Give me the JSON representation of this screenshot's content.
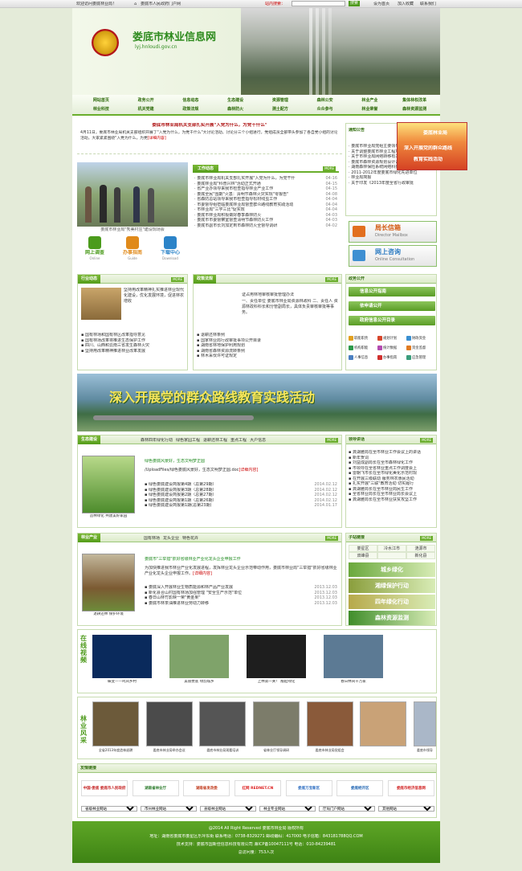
{
  "topbar": {
    "welcome": "欢迎访问娄底林业局！",
    "portal": "娄底市人民政府门户网",
    "search_label": "站内搜索：",
    "search_button": "搜索",
    "links": [
      "设为首页",
      "加入收藏",
      "联系我们"
    ]
  },
  "header": {
    "title": "娄底市林业信息网",
    "url": "lyj.hnloudi.gov.cn"
  },
  "nav": {
    "row1": [
      "网站首页",
      "政务公开",
      "信息动态",
      "生态建设",
      "资源管理",
      "森林公安",
      "林业产业",
      "集体林权改革"
    ],
    "row2": [
      "林业科技",
      "机关党建",
      "政策法规",
      "森林防火",
      "测土配方",
      "众众参与",
      "林业荣誉",
      "森林资源监测"
    ]
  },
  "headline": {
    "title": "娄底市林业局机关支部扎实开展\"入党为什么，为党干什么\"",
    "body": "4月11日，娄底市林业局机关支部组织开展了\"入党为什么，为党干什么\"大讨论活动，讨论分三个小组进行，党组成员全部带头参加了各自党小组的讨论活动。大家紧紧围绕\"入党为什么，为党",
    "more": "[详细内容]",
    "photo_caption": "娄底市林业局\"秀美村庄\"建设现场会"
  },
  "quick_links": [
    {
      "label": "网上调查",
      "sub": "Online"
    },
    {
      "label": "办事指南",
      "sub": "Guide"
    },
    {
      "label": "下载中心",
      "sub": "Download"
    }
  ],
  "work_news": {
    "title": "工作动态",
    "more": "MORE",
    "items": [
      {
        "text": "娄底市林业局机关支部扎实开展\"入党为什么，为党干什",
        "date": "04-16"
      },
      {
        "text": "娄底林业局\"科普兴林\"活动正式开通",
        "date": "04-15"
      },
      {
        "text": "省产业办领导来我市检查指导林业产业工作",
        "date": "04-15"
      },
      {
        "text": "娄底全民\"围剿\"火患：清明节森林火灾实现\"零报告\"",
        "date": "04-08"
      },
      {
        "text": "省森防总站领导来我市检查指导松材线虫工作",
        "date": "04-04"
      },
      {
        "text": "市委督导组莅临娄底林业局督查群众路线教育实践活动",
        "date": "04-04"
      },
      {
        "text": "市林业局\"三学三比\"促实效",
        "date": "04-04"
      },
      {
        "text": "娄底市林业局积极做好春季森林防火",
        "date": "04-03"
      },
      {
        "text": "娄底市市委督察室督查清明节森林防火工作",
        "date": "04-03"
      },
      {
        "text": "娄底市副市长刘加定到市森林防火全督导调研",
        "date": "04-02"
      }
    ]
  },
  "notice": {
    "title": "通知公告",
    "banner": [
      "娄底林业局",
      "深入开展党的群众路线",
      "教育实践活动"
    ],
    "items": [
      "娄底市林业局党组主要领导联系点",
      "关于调整娄底市林业工程项目建设",
      "关于市林业局网络转移有关事项的通",
      "娄底市森林资源规划设计调查招标公",
      "湖南森林保险系统网络科技工程建设",
      "2011-2012年度娄底市绿化先进单位",
      "林业局简报",
      "关于印发《2013年度全省行政审批"
    ]
  },
  "mailbox": {
    "label": "局长信箱",
    "sub": "Director Mailbox"
  },
  "consult": {
    "label": "网上咨询",
    "sub": "Online Consultation"
  },
  "industry_news": {
    "title": "行业动态",
    "more": "MORE",
    "lead": "坚持用改革精神扎实推进林业现代化建设，优化发展环境，促进林农增收",
    "items": [
      "国有林场和国有林区改革指导意见",
      "国有林场改革将推进生态保护工作",
      "四川、山西和云南三省发生森林火灾",
      "坚持用改革精神推进林业改革发展"
    ]
  },
  "policy": {
    "title": "政策法规",
    "more": "MORE",
    "lead": "证占用林地审核审批管理办法",
    "body": "一、责任单位 娄底市林业局资源林政科 二、责任人 资源林政科科长和分管副局长，具体负责审核审批等事务。",
    "items": [
      "退耕还林条例",
      "国家林业局行政审批事项公开目录",
      "湖南省林地保护利用规划",
      "湖南省森林资源流转条例",
      "林木采伐许可证规定"
    ]
  },
  "gov_open": {
    "title": "政务公开",
    "buttons": [
      "信息公开指南",
      "依申请公开",
      "政府信息公开目录"
    ],
    "icons": [
      "职能职责",
      "规划计划",
      "财政资金",
      "机构职能",
      "统计数据",
      "资金监督",
      "人事信息",
      "办事指南",
      "应急管理"
    ]
  },
  "banner_main": "深入开展党的群众路线教育实践活动",
  "eco": {
    "title": "生态建设",
    "tabs": [
      "森林四年绿化行动",
      "绿色家园工程",
      "退耕还林工程",
      "重点工程",
      "大户信息"
    ],
    "more": "MORE",
    "lead_title": "绿色娄底风景好，生态文明梦正圆",
    "lead_text": "/UploadFiles/绿色娄底风景好，生态文明梦正圆.doc",
    "more_link": "[详细内容]",
    "items": [
      {
        "text": "绿色娄底建设简报第4期（总第29期）",
        "date": "2014.02.12"
      },
      {
        "text": "绿色娄底建设简报第3期（总第28期）",
        "date": "2014.02.12"
      },
      {
        "text": "绿色娄底建设简报第2期（总第27期）",
        "date": "2014.02.12"
      },
      {
        "text": "绿色娄底建设简报第1期（总第26期）",
        "date": "2014.02.12"
      },
      {
        "text": "绿色娄底建设简报第1期(总第23期)",
        "date": "2014.01.17"
      }
    ],
    "photo_caption": "造林绿化 共建美好家园"
  },
  "leaders": {
    "title": "领导讲话",
    "more": "MORE",
    "items": [
      "龚湖雅局在全市林业工作会议上的讲话",
      "新年贺词",
      "刘益成副局长在全市森林绿化工作",
      "市领导在全省林业重点工作调度会上",
      "雷朝飞市长在全市绿化美化示范村现",
      "在开展三级联动 服务林农惠民活动",
      "扎实开展\"三联\"教育活动 切实履行",
      "龚湖雅局长在全市林业局民生工作",
      "全省林业局长在全市林业局长会议上",
      "龚湖雅局长在全市林业扶贫攻坚工作"
    ]
  },
  "forest_industry": {
    "title": "林业产业",
    "tabs": [
      "国有林场",
      "龙头企业",
      "特色花卉"
    ],
    "more": "MORE",
    "lead_title": "娄底市\"三举措\"抓好省级林业产业化龙头企业申报工作",
    "lead_text": "为加快推进我市林业产业化发展进程，发挥林业龙头企业示范带动作用，娄底市林业局\"三举措\"抓好省级林业产业化龙头企业申报工作。",
    "more_link": "[详细内容]",
    "items": [
      {
        "text": "娄底深入开展林业生物质能源和林产品产业发展",
        "date": "2013.12.03"
      },
      {
        "text": "新化县合山村国有林场加强管理 \"安全生产示范\"单位",
        "date": "2013.12.03"
      },
      {
        "text": "春日山林竹影映一荣\"黄金果\"",
        "date": "2013.12.03"
      },
      {
        "text": "娄底市林茶油推进林业劳动力转移",
        "date": "2013.12.03"
      }
    ],
    "photo_caption": "退耕还林 保护环境"
  },
  "friend_links": {
    "title": "子站链接",
    "more": "MORE",
    "districts": [
      "娄星区",
      "冷水江市",
      "涟源市",
      "双峰县",
      "",
      "新化县"
    ],
    "tiles": [
      "城乡绿化",
      "湘绿保护行动",
      "四年绿化行动",
      "森林资源监测"
    ]
  },
  "video": {
    "title": "在线视频",
    "items": [
      "蝶变——鸣凤乡村",
      "美丽娄底 绿韵城乡",
      "上林第一关！ 靓起绿化",
      "春日林间千万家"
    ]
  },
  "scenery": {
    "title": "林业风采",
    "items": [
      "全省2013年度造林退耕",
      "娄底市林业局举办会议",
      "娄底市林业局观看培训",
      "省林业厅领导调研",
      "娄底市林业局党组会",
      "",
      "娄底市领导"
    ]
  },
  "links": {
    "title": "友情链接",
    "logos": [
      "中国·娄底 娄底市人民政府",
      "湖南省林业厅",
      "湖南省发改委",
      "红网 REDNET.CN",
      "娄底万宝新区",
      "娄底经开区",
      "娄底市经济信息网"
    ],
    "selects": [
      "省级林业网站",
      "市州林业网站",
      "县级林业网站",
      "林业专业网站",
      "厅局门户网站",
      "其他网站"
    ]
  },
  "footer": {
    "copyright": "@2014 All Right Reserved 娄底市林业局 版权所有",
    "address": "地址：湖南省娄底市娄星区乐坪东街 联系电话：0738-8329271 邮政编码：417000 电子信箱：843181788QQ.COM",
    "support": "技术支持：娄底市国新佳信息科技有限公司 湘ICP备10047111号 电话：010-84239481",
    "visits": "总访问量：753人次"
  },
  "colors": {
    "primary": "#559d1b",
    "dark": "#2e6b0b",
    "alert": "#c00000",
    "bg": "#e4ebd9"
  }
}
